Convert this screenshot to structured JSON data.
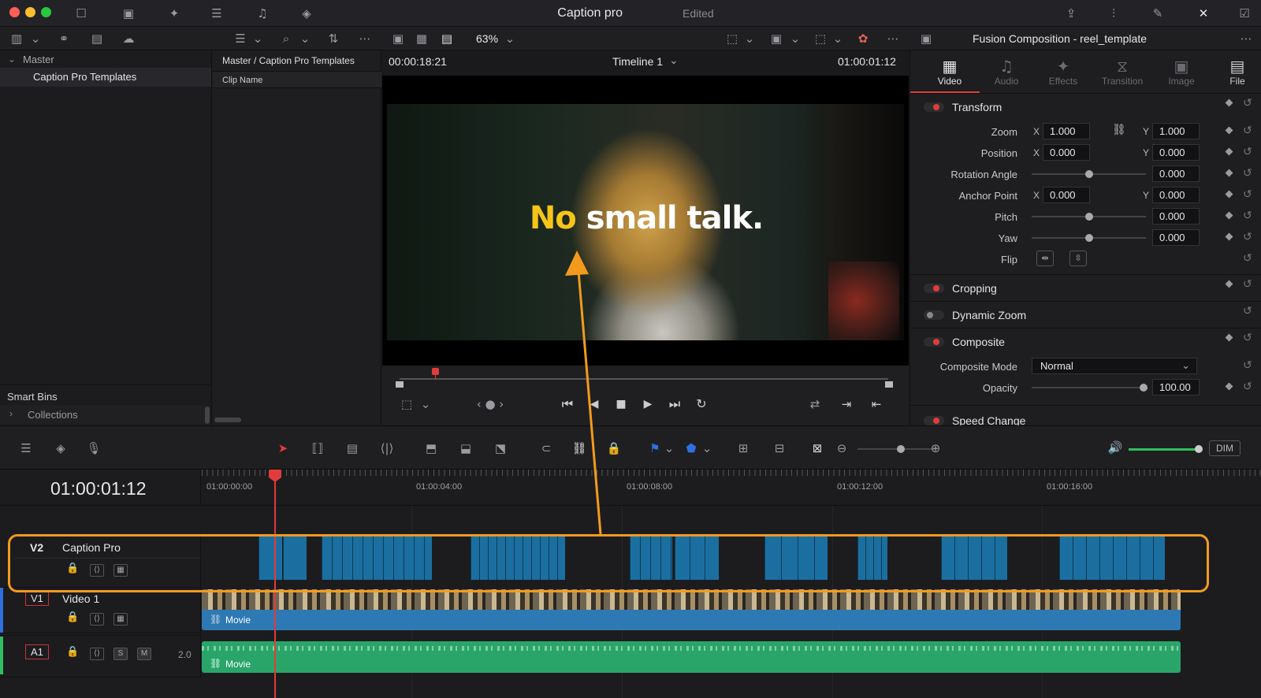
{
  "app": {
    "title": "Caption pro",
    "status": "Edited"
  },
  "toolbar": {
    "zoom": "63%"
  },
  "media_pool": {
    "root": "Master",
    "bin": "Caption Pro Templates",
    "smart_bins": "Smart Bins",
    "collections": "Collections"
  },
  "bin_panel": {
    "path": "Master / Caption Pro Templates",
    "column": "Clip Name"
  },
  "viewer": {
    "source_tc": "00:00:18:21",
    "timeline_name": "Timeline 1",
    "record_tc": "01:00:01:12",
    "caption_word1": "No",
    "caption_rest": "small talk.",
    "caption_color": "#f5c518"
  },
  "inspector": {
    "title": "Fusion Composition - reel_template",
    "tabs": [
      "Video",
      "Audio",
      "Effects",
      "Transition",
      "Image",
      "File"
    ],
    "transform": {
      "title": "Transform",
      "zoom_label": "Zoom",
      "zoom_x": "1.000",
      "zoom_y": "1.000",
      "position_label": "Position",
      "pos_x": "0.000",
      "pos_y": "0.000",
      "rotation_label": "Rotation Angle",
      "rotation": "0.000",
      "anchor_label": "Anchor Point",
      "anchor_x": "0.000",
      "anchor_y": "0.000",
      "pitch_label": "Pitch",
      "pitch": "0.000",
      "yaw_label": "Yaw",
      "yaw": "0.000",
      "flip_label": "Flip",
      "x": "X",
      "y": "Y"
    },
    "cropping": "Cropping",
    "dynamic_zoom": "Dynamic Zoom",
    "composite": {
      "title": "Composite",
      "mode_label": "Composite Mode",
      "mode": "Normal",
      "opacity_label": "Opacity",
      "opacity": "100.00"
    },
    "speed_change": "Speed Change"
  },
  "timeline": {
    "timecode": "01:00:01:12",
    "ruler": [
      "01:00:00:00",
      "01:00:04:00",
      "01:00:08:00",
      "01:00:12:00",
      "01:00:16:00"
    ],
    "dim": "DIM",
    "tracks": {
      "v2": {
        "id": "V2",
        "name": "Caption Pro"
      },
      "v1": {
        "id": "V1",
        "name": "Video 1",
        "clip": "Movie"
      },
      "a1": {
        "id": "A1",
        "clip": "Movie",
        "level": "2.0",
        "s": "S",
        "m": "M"
      }
    },
    "highlight_color": "#f39a1e"
  }
}
